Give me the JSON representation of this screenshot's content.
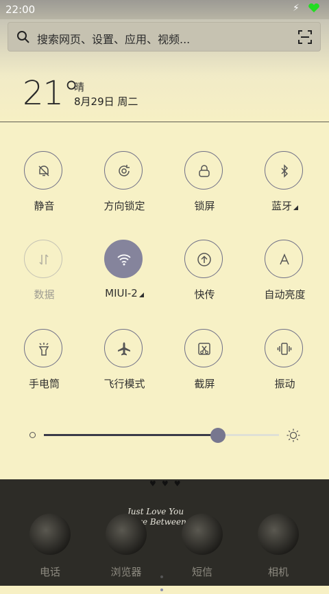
{
  "status_bar": {
    "time": "22:00",
    "charging_icon": "lightning-icon",
    "battery_icon": "battery-icon",
    "battery_color": "#22dd22"
  },
  "search": {
    "placeholder": "搜索网页、设置、应用、视频...",
    "search_icon": "search-icon",
    "scan_icon": "scan-icon"
  },
  "weather": {
    "temperature": "21°",
    "condition": "晴",
    "date": "8月29日 周二"
  },
  "toggles": [
    {
      "label": "静音",
      "icon": "bell-off-icon",
      "state": "off"
    },
    {
      "label": "方向锁定",
      "icon": "rotation-lock-icon",
      "state": "off"
    },
    {
      "label": "锁屏",
      "icon": "lock-icon",
      "state": "off"
    },
    {
      "label": "蓝牙",
      "icon": "bluetooth-icon",
      "state": "off",
      "has_more": true
    },
    {
      "label": "数据",
      "icon": "data-arrows-icon",
      "state": "disabled"
    },
    {
      "label": "MIUI-2",
      "icon": "wifi-icon",
      "state": "on",
      "has_more": true
    },
    {
      "label": "快传",
      "icon": "upload-icon",
      "state": "off"
    },
    {
      "label": "自动亮度",
      "icon": "auto-brightness-icon",
      "state": "off"
    },
    {
      "label": "手电筒",
      "icon": "flashlight-icon",
      "state": "off"
    },
    {
      "label": "飞行模式",
      "icon": "airplane-icon",
      "state": "off"
    },
    {
      "label": "截屏",
      "icon": "screenshot-icon",
      "state": "off"
    },
    {
      "label": "振动",
      "icon": "vibrate-icon",
      "state": "off"
    }
  ],
  "brightness": {
    "level": 0.74,
    "icon": "sun-icon"
  },
  "wallpaper_text": [
    "Just Love You",
    "Love Between Us"
  ],
  "dock": [
    {
      "label": "电话"
    },
    {
      "label": "浏览器"
    },
    {
      "label": "短信"
    },
    {
      "label": "相机"
    }
  ],
  "colors": {
    "panel": "#f7f1c6",
    "accent_toggle": "#85849c",
    "dock_bg": "#2d2c27"
  }
}
